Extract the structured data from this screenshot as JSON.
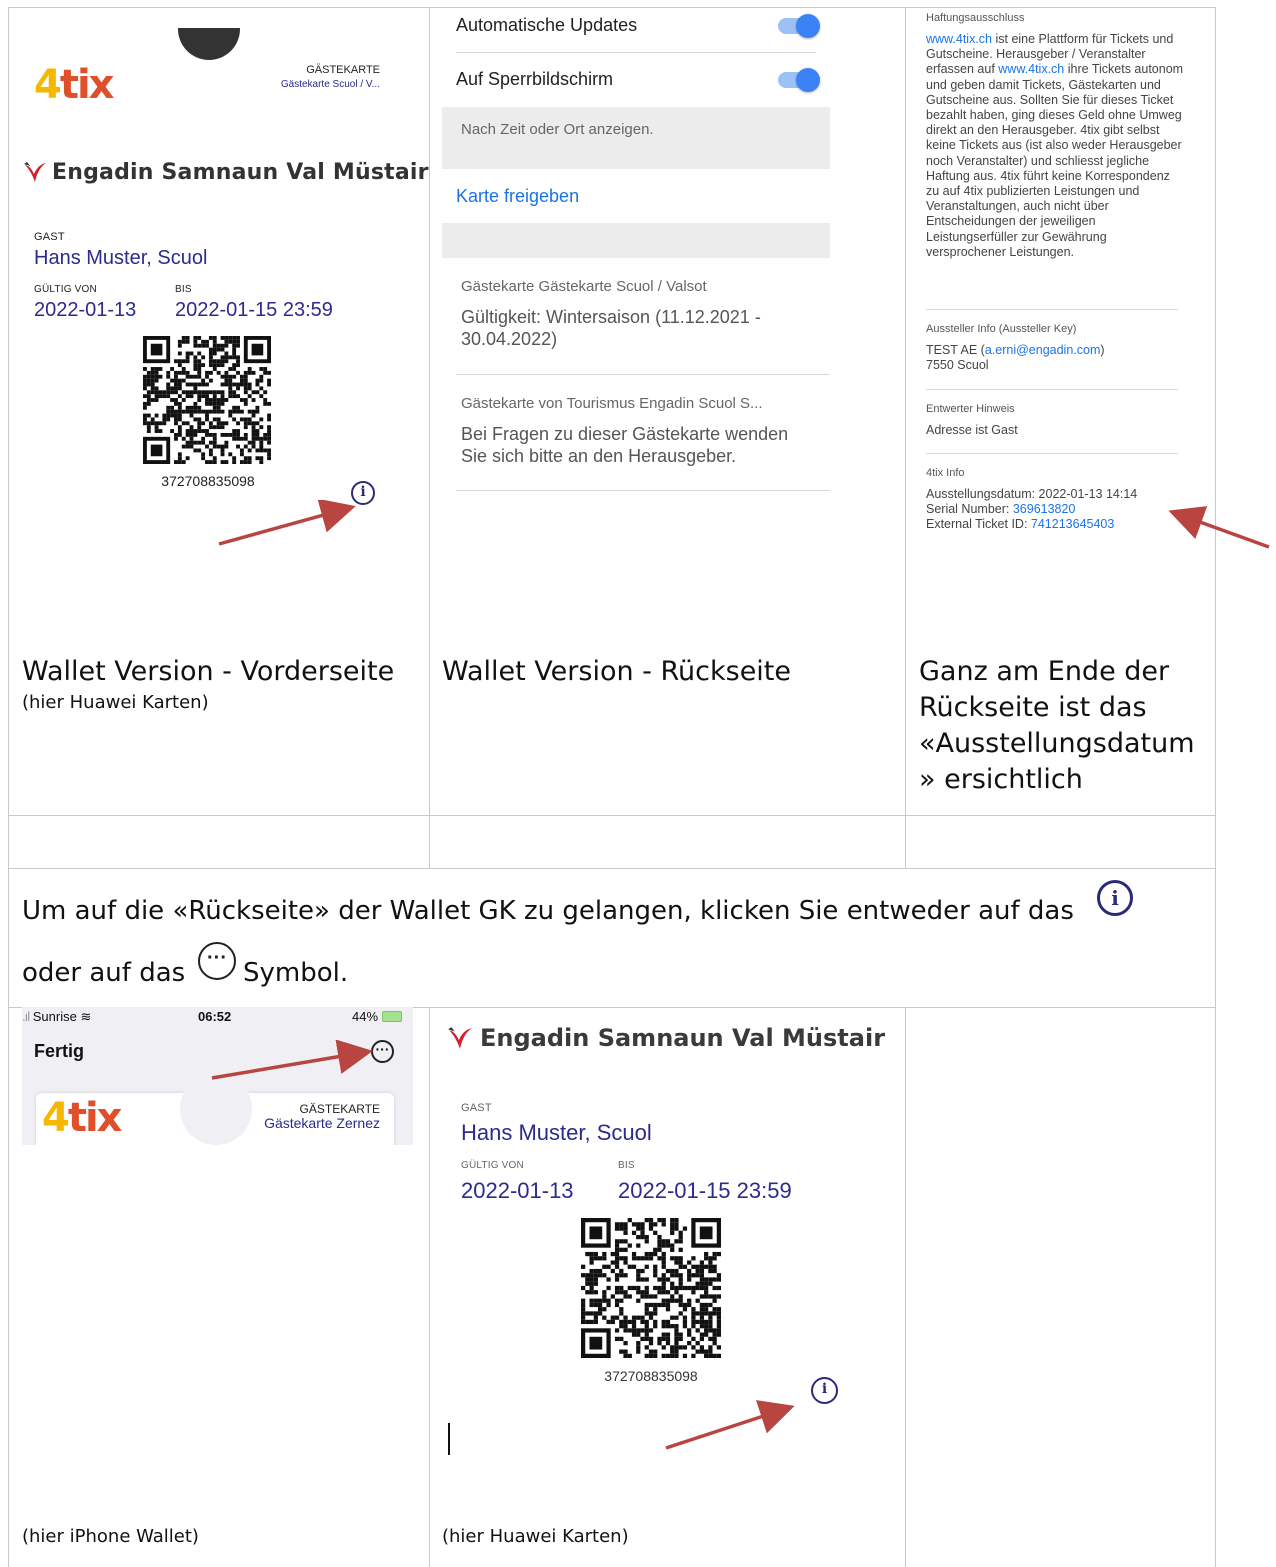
{
  "panel1": {
    "brand": "4tix",
    "card_type": "GÄSTEKARTE",
    "card_sub": "Gästekarte Scuol / V...",
    "region": "Engadin Samnaun Val Müstair",
    "guest_label": "GAST",
    "guest_name": "Hans Muster, Scuol",
    "valid_from_label": "GÜLTIG VON",
    "valid_to_label": "BIS",
    "valid_from": "2022-01-13",
    "valid_to": "2022-01-15 23:59",
    "code": "372708835098",
    "caption_title": "Wallet Version - Vorderseite",
    "caption_sub": "(hier Huawei Karten)"
  },
  "panel2": {
    "auto_updates": "Automatische Updates",
    "lock_screen": "Auf Sperrbildschirm",
    "hint": "Nach Zeit oder Ort anzeigen.",
    "share": "Karte freigeben",
    "item1_title": "Gästekarte Gästekarte Scuol / Valsot",
    "item1_body": "Gültigkeit: Wintersaison (11.12.2021 - 30.04.2022)",
    "item2_title": "Gästekarte von Tourismus Engadin Scuol S...",
    "item2_body": "Bei Fragen zu dieser Gästekarte wenden Sie sich bitte an den Herausgeber.",
    "caption_title": "Wallet Version - Rückseite"
  },
  "panel3": {
    "disclaimer_label": "Haftungsausschluss",
    "disclaimer_link1": "www.4tix.ch",
    "disclaimer_text1": " ist eine Plattform für Tickets und Gutscheine. Herausgeber / Veranstalter erfassen auf ",
    "disclaimer_link2": "www.4tix.ch",
    "disclaimer_text2": " ihre Tickets autonom und geben damit Tickets, Gästekarten und Gutscheine aus. Sollten Sie für dieses Ticket bezahlt haben, ging dieses Geld ohne Umweg direkt an den Herausgeber. 4tix gibt selbst keine Tickets aus (ist also weder Herausgeber noch Veranstalter) und schliesst jegliche Haftung aus. 4tix führt keine Korrespondenz zu auf 4tix publizierten Leistungen und Veranstaltungen, auch nicht über Entscheidungen der jeweiligen Leistungserfüller zur Gewährung versprochener Leistungen.",
    "issuer_label": "Aussteller Info (Aussteller Key)",
    "issuer_line1_pre": "TEST AE (",
    "issuer_email": "a.erni@engadin.com",
    "issuer_line1_post": ")",
    "issuer_line2": "7550 Scuol",
    "validator_label": "Entwerter Hinweis",
    "validator_value": "Adresse ist Gast",
    "info_label": "4tix Info",
    "issue_date": "Ausstellungsdatum: 2022-01-13 14:14",
    "serial_label": "Serial Number: ",
    "serial_value": "369613820",
    "ext_label": "External Ticket ID: ",
    "ext_value": "741213645403",
    "caption": "Ganz am Ende der Rückseite ist das «Ausstellungsdatum » ersichtlich"
  },
  "instruction": {
    "part1": "Um auf die «Rückseite» der Wallet GK zu gelangen, klicken Sie entweder auf das",
    "part2": "oder auf das",
    "part3": "Symbol."
  },
  "panel4": {
    "carrier": "Sunrise",
    "time": "06:52",
    "battery": "44%",
    "done": "Fertig",
    "brand": "4tix",
    "card_type": "GÄSTEKARTE",
    "card_sub": "Gästekarte Zernez",
    "caption": "(hier iPhone Wallet)"
  },
  "panel5": {
    "region": "Engadin Samnaun Val Müstair",
    "guest_label": "GAST",
    "guest_name": "Hans Muster, Scuol",
    "valid_from_label": "GÜLTIG VON",
    "valid_to_label": "BIS",
    "valid_from": "2022-01-13",
    "valid_to": "2022-01-15 23:59",
    "code": "372708835098",
    "caption": "(hier Huawei Karten)"
  }
}
